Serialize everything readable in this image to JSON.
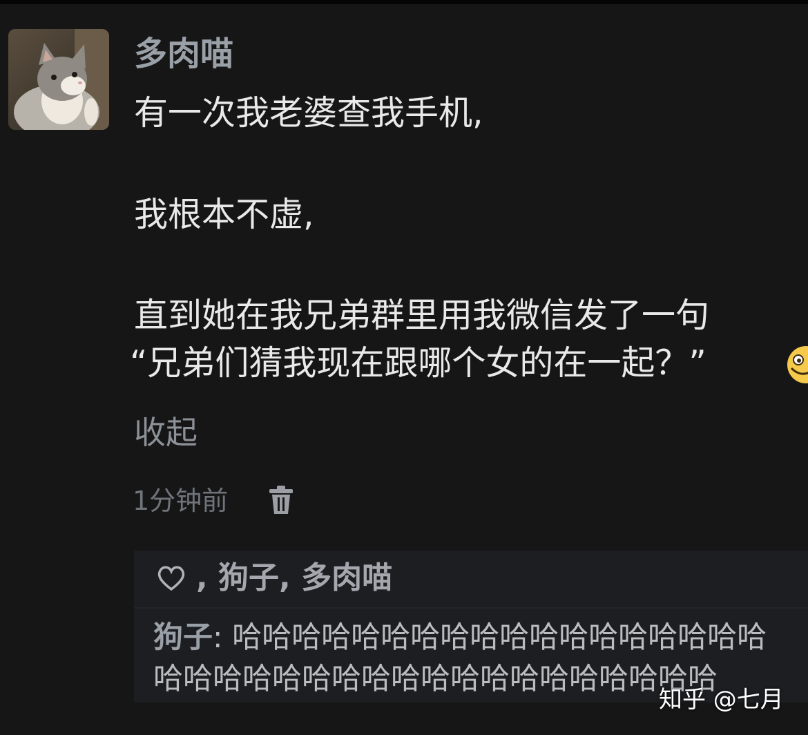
{
  "comment": {
    "author": "多肉喵",
    "lines": [
      "有一次我老婆查我手机,",
      "我根本不虚,",
      "直到她在我兄弟群里用我微信发了一句",
      "“兄弟们猜我现在跟哪个女的在一起？”"
    ],
    "collapse_label": "收起",
    "time": "1分钟前"
  },
  "reply_box": {
    "likes_text": ", 狗子, 多肉喵",
    "reply_author": "狗子",
    "reply_separator": ": ",
    "reply_text_line1": "哈哈哈哈哈哈哈哈哈哈哈哈哈哈哈哈哈哈",
    "reply_text_line2": "哈哈哈哈哈哈哈哈哈哈哈哈哈哈哈哈哈哈哈"
  },
  "watermark": "知乎 @七月",
  "icons": {
    "avatar": "cat-avatar",
    "emoji": "grinning-emoji-icon",
    "trash": "trash-icon",
    "heart": "heart-icon"
  },
  "colors": {
    "background": "#161616",
    "author_name": "#9aa0a8",
    "body_text": "#e9e9e9",
    "muted_text": "#70747a",
    "reply_box": "#1d1e21"
  }
}
